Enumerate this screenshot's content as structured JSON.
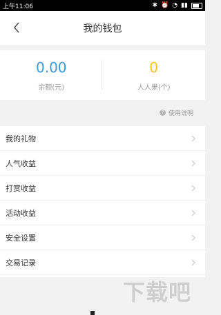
{
  "status_bar": {
    "time": "上午11:06",
    "icons": [
      "bluetooth-icon",
      "alarm-icon",
      "wifi-icon",
      "signal-icon",
      "battery-icon"
    ]
  },
  "navbar": {
    "title": "我的钱包"
  },
  "wallet": {
    "balance": {
      "value": "0.00",
      "label": "余额(元)"
    },
    "apples": {
      "value": "0",
      "label": "人人果(个)"
    }
  },
  "help": {
    "label": "使用说明"
  },
  "menu": {
    "items": [
      {
        "label": "我的礼物"
      },
      {
        "label": "人气收益"
      },
      {
        "label": "打赏收益"
      },
      {
        "label": "活动收益"
      },
      {
        "label": "安全设置"
      },
      {
        "label": "交易记录"
      }
    ]
  },
  "colors": {
    "balance_blue": "#3a9ad9",
    "apple_yellow": "#f5c518"
  },
  "watermark": {
    "text": "下载吧"
  }
}
